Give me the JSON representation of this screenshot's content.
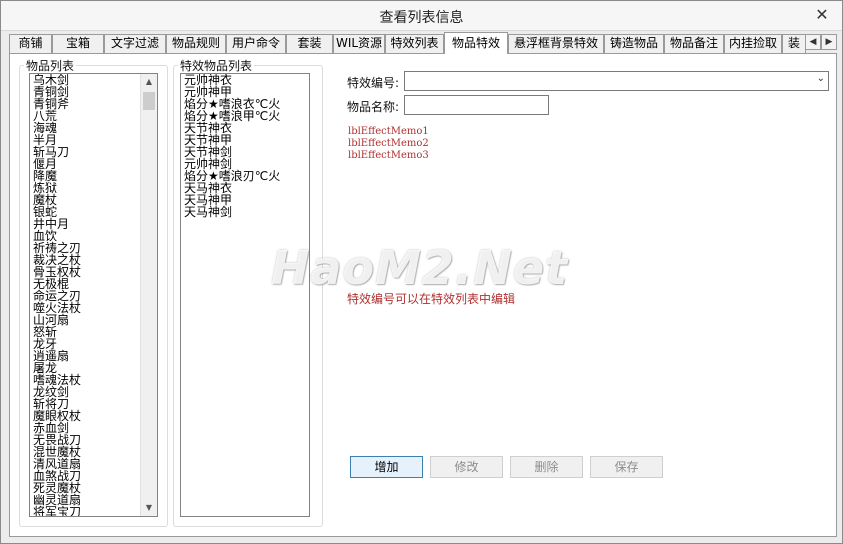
{
  "window": {
    "title": "查看列表信息",
    "close_glyph": "✕"
  },
  "tabs": [
    {
      "label": "商铺"
    },
    {
      "label": "宝箱"
    },
    {
      "label": "文字过滤"
    },
    {
      "label": "物品规则"
    },
    {
      "label": "用户命令"
    },
    {
      "label": "套装"
    },
    {
      "label": "WIL资源"
    },
    {
      "label": "特效列表"
    },
    {
      "label": "物品特效"
    },
    {
      "label": "悬浮框背景特效"
    },
    {
      "label": "铸造物品"
    },
    {
      "label": "物品备注"
    },
    {
      "label": "内挂捡取"
    },
    {
      "label": "装"
    }
  ],
  "active_tab": "物品特效",
  "item_list": {
    "legend": "物品列表",
    "items": [
      "乌木剑",
      "青铜剑",
      "青铜斧",
      "八荒",
      "海魂",
      "半月",
      "斩马刀",
      "偃月",
      "降魔",
      "炼狱",
      "魔杖",
      "银蛇",
      "井中月",
      "血饮",
      "祈祷之刃",
      "裁决之杖",
      "骨玉权杖",
      "无极棍",
      "命运之刃",
      "噬火法杖",
      "山河扇",
      "怒斩",
      "龙牙",
      "逍遥扇",
      "屠龙",
      "嗜魂法杖",
      "龙纹剑",
      "斩将刀",
      "魔眼权杖",
      "赤血剑",
      "无畏战刀",
      "混世魔杖",
      "清风道扇",
      "血煞战刀",
      "死灵魔杖",
      "幽灵道扇",
      "将军宝刀"
    ]
  },
  "effect_item_list": {
    "legend": "特效物品列表",
    "items": [
      "元帅神衣",
      "元帅神甲",
      "焰分★嗜浪衣℃火",
      "焰分★嗜浪甲℃火",
      "天节神衣",
      "天节神甲",
      "天节神剑",
      "元帅神剑",
      "焰分★嗜浪刃℃火",
      "天马神衣",
      "天马神甲",
      "天马神剑"
    ]
  },
  "form": {
    "effect_id_label": "特效编号:",
    "effect_id_value": "",
    "item_name_label": "物品名称:",
    "item_name_value": "",
    "memos": [
      "lblEffectMemo1",
      "lblEffectMemo2",
      "lblEffectMemo3"
    ],
    "hint": "特效编号可以在特效列表中编辑"
  },
  "buttons": {
    "add": "增加",
    "edit": "修改",
    "delete": "删除",
    "save": "保存"
  },
  "watermark": "HaoM2.Net",
  "colors": {
    "memo_text": "#b03030",
    "accent": "#3c7fb1"
  }
}
